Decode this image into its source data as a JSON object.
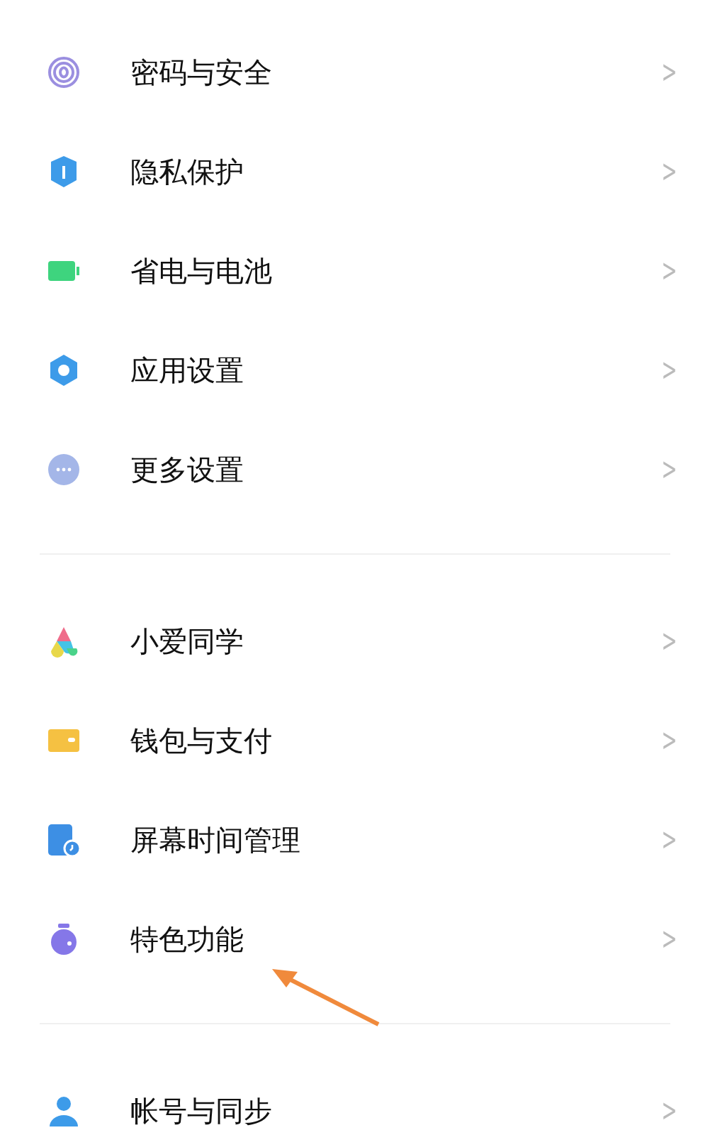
{
  "sections": [
    {
      "items": [
        {
          "kind": "fingerprint",
          "label": "密码与安全",
          "chevron": ">"
        },
        {
          "kind": "shield",
          "label": "隐私保护",
          "chevron": ">"
        },
        {
          "kind": "battery",
          "label": "省电与电池",
          "chevron": ">"
        },
        {
          "kind": "gear",
          "label": "应用设置",
          "chevron": ">"
        },
        {
          "kind": "more",
          "label": "更多设置",
          "chevron": ">"
        }
      ]
    },
    {
      "items": [
        {
          "kind": "assistant",
          "label": "小爱同学",
          "chevron": ">"
        },
        {
          "kind": "wallet",
          "label": "钱包与支付",
          "chevron": ">"
        },
        {
          "kind": "screentime",
          "label": "屏幕时间管理",
          "chevron": ">"
        },
        {
          "kind": "flask",
          "label": "特色功能",
          "chevron": ">"
        }
      ]
    },
    {
      "items": [
        {
          "kind": "person",
          "label": "帐号与同步",
          "chevron": ">"
        }
      ]
    }
  ]
}
